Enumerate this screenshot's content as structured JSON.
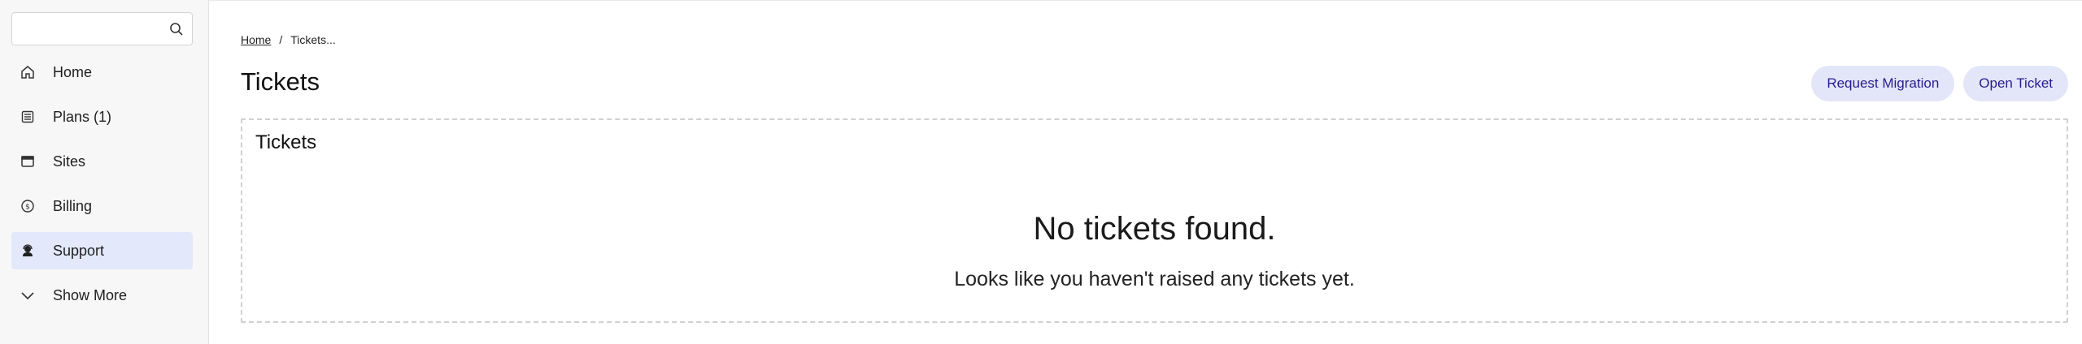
{
  "sidebar": {
    "search": {
      "placeholder": "",
      "value": ""
    },
    "items": [
      {
        "label": "Home",
        "icon": "home-icon"
      },
      {
        "label": "Plans (1)",
        "icon": "list-icon"
      },
      {
        "label": "Sites",
        "icon": "browser-window-icon"
      },
      {
        "label": "Billing",
        "icon": "dollar-circle-icon"
      },
      {
        "label": "Support",
        "icon": "support-agent-icon",
        "active": true
      },
      {
        "label": "Show More",
        "icon": "chevron-down-icon"
      }
    ]
  },
  "breadcrumb": {
    "home": "Home",
    "separator": "/",
    "current": "Tickets..."
  },
  "page": {
    "title": "Tickets"
  },
  "actions": {
    "request_migration": "Request Migration",
    "open_ticket": "Open Ticket"
  },
  "panel": {
    "title": "Tickets",
    "empty_title": "No tickets found.",
    "empty_subtitle": "Looks like you haven't raised any tickets yet."
  },
  "colors": {
    "active_bg": "#e3e8fb",
    "button_bg": "#e3e6f8",
    "button_text": "#2a1b8f"
  }
}
